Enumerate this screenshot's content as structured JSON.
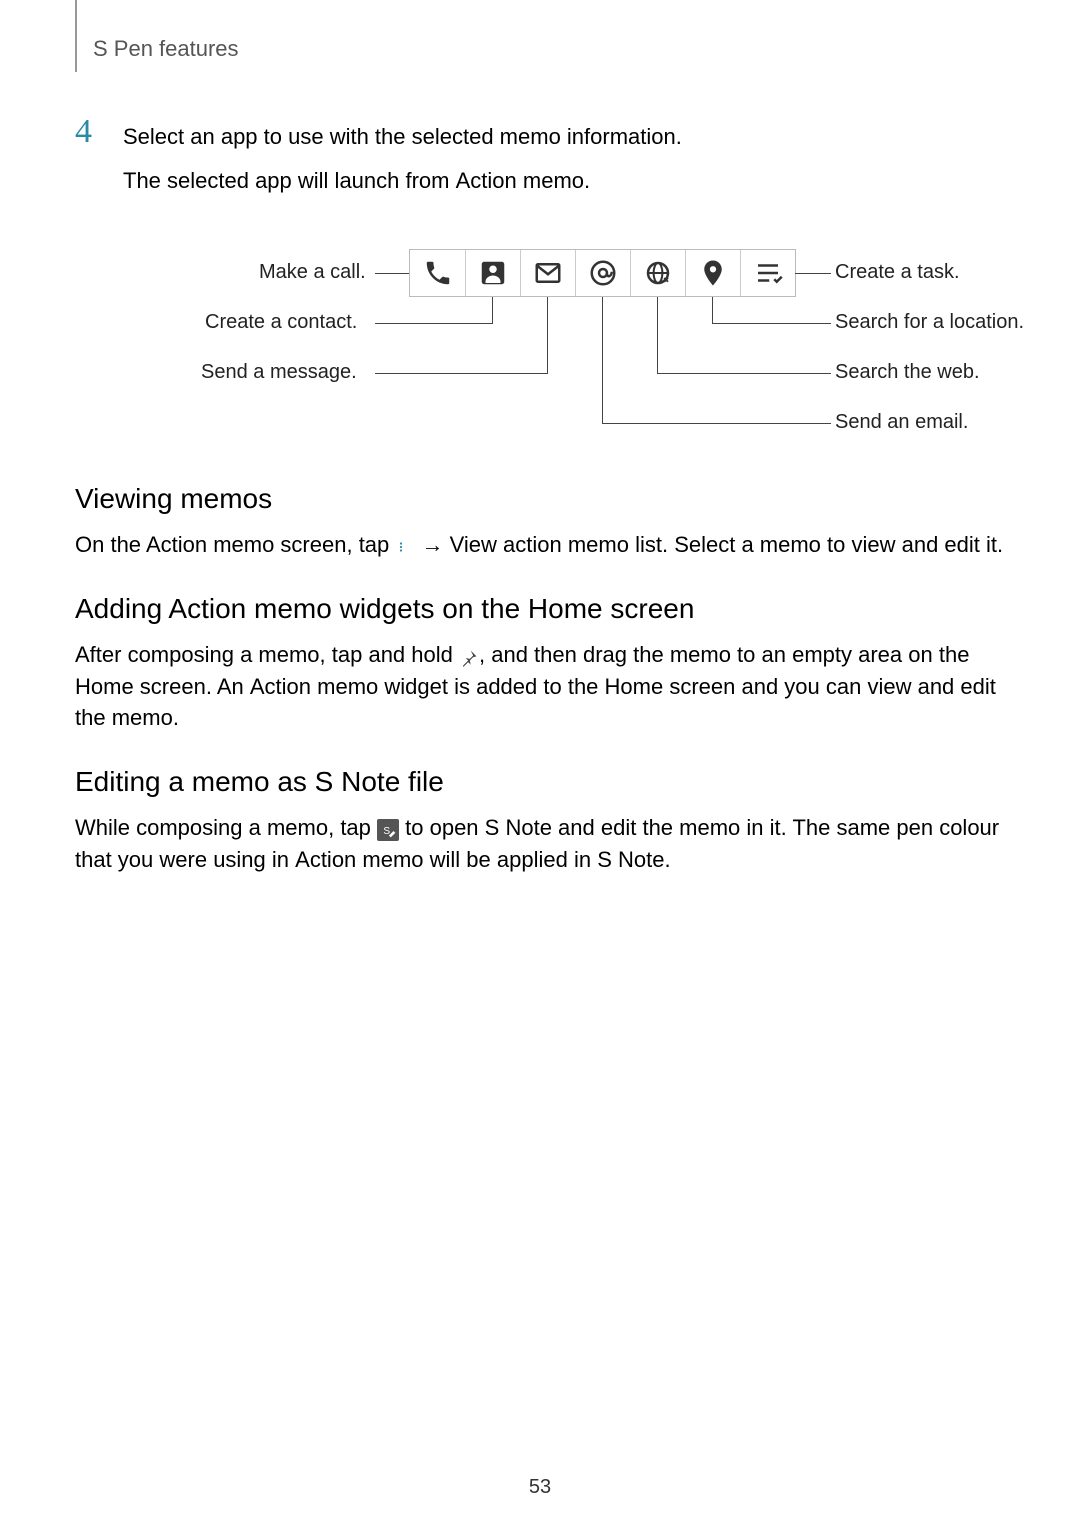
{
  "header": {
    "title": "S Pen features"
  },
  "step": {
    "number": "4",
    "line1": "Select an app to use with the selected memo information.",
    "line2_a": "The selected app will launch from ",
    "line2_b": "Action memo",
    "line2_c": "."
  },
  "diagram": {
    "left": {
      "call": "Make a call.",
      "contact": "Create a contact.",
      "message": "Send a message."
    },
    "right": {
      "task": "Create a task.",
      "location": "Search for a location.",
      "web": "Search the web.",
      "email": "Send an email."
    }
  },
  "sections": {
    "viewing": {
      "heading": "Viewing memos",
      "p1_a": "On the Action memo screen, tap ",
      "p1_b": " → ",
      "p1_c": "View action memo list",
      "p1_d": ". Select a memo to view and edit it."
    },
    "adding": {
      "heading": "Adding Action memo widgets on the Home screen",
      "p1_a": "After composing a memo, tap and hold ",
      "p1_b": ", and then drag the memo to an empty area on the Home screen. An ",
      "p1_c": "Action memo",
      "p1_d": " widget is added to the Home screen and you can view and edit the memo."
    },
    "editing": {
      "heading": "Editing a memo as S Note file",
      "p1_a": "While composing a memo, tap ",
      "p1_b": " to open ",
      "p1_c": "S Note",
      "p1_d": " and edit the memo in it. The same pen colour that you were using in ",
      "p1_e": "Action memo",
      "p1_f": " will be applied in ",
      "p1_g": "S Note",
      "p1_h": "."
    }
  },
  "page_number": "53"
}
